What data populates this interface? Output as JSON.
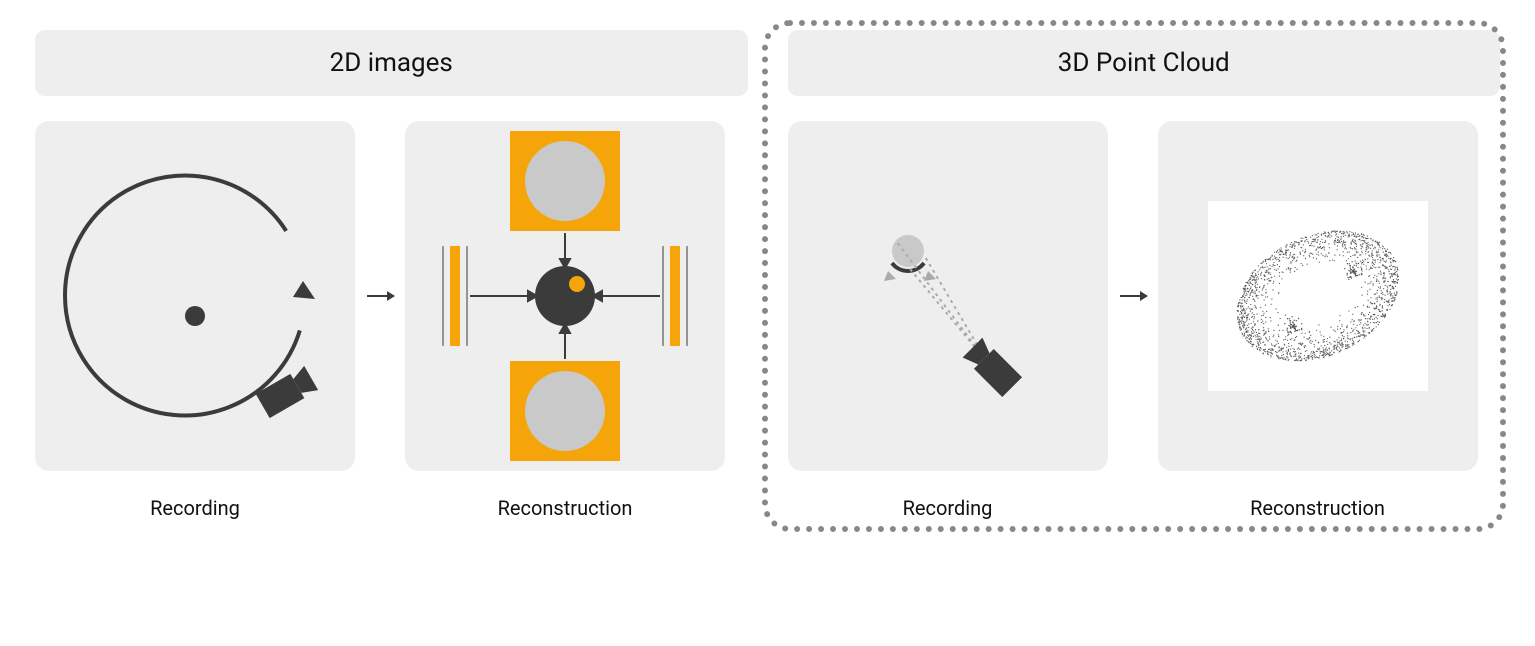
{
  "sections": {
    "left": {
      "title": "2D images",
      "panel1_caption": "Recording",
      "panel2_caption": "Reconstruction"
    },
    "right": {
      "title": "3D Point Cloud",
      "panel1_caption": "Recording",
      "panel2_caption": "Reconstruction"
    }
  },
  "colors": {
    "panel_bg": "#eeeeee",
    "dark": "#3b3b3b",
    "orange": "#f5a40a",
    "orange_light": "#f5a40a",
    "grey_circle": "#c9c9c9"
  },
  "diagram": {
    "type": "process-comparison",
    "left_method": "2D images: multi-view camera capture → photo reconstruction",
    "right_method": "3D Point Cloud: depth scanner capture → point cloud reconstruction"
  }
}
